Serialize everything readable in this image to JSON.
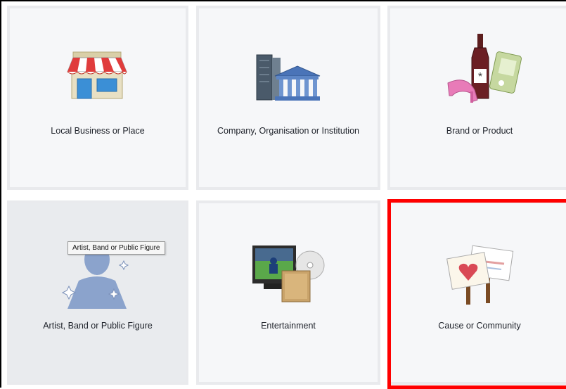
{
  "tiles": [
    {
      "label": "Local Business or Place",
      "icon": "storefront-icon"
    },
    {
      "label": "Company, Organisation or Institution",
      "icon": "buildings-icon"
    },
    {
      "label": "Brand or Product",
      "icon": "products-icon"
    },
    {
      "label": "Artist, Band or Public Figure",
      "icon": "person-silhouette-icon"
    },
    {
      "label": "Entertainment",
      "icon": "media-icon"
    },
    {
      "label": "Cause or Community",
      "icon": "protest-signs-icon"
    }
  ],
  "tooltip": {
    "text": "Artist, Band or Public Figure"
  },
  "highlight": {
    "color": "#ff0000",
    "tile": "Cause or Community"
  },
  "colors": {
    "tile_bg": "#f6f7f9",
    "tile_border": "#e9eaed",
    "fb_blue": "#4a6bad"
  }
}
